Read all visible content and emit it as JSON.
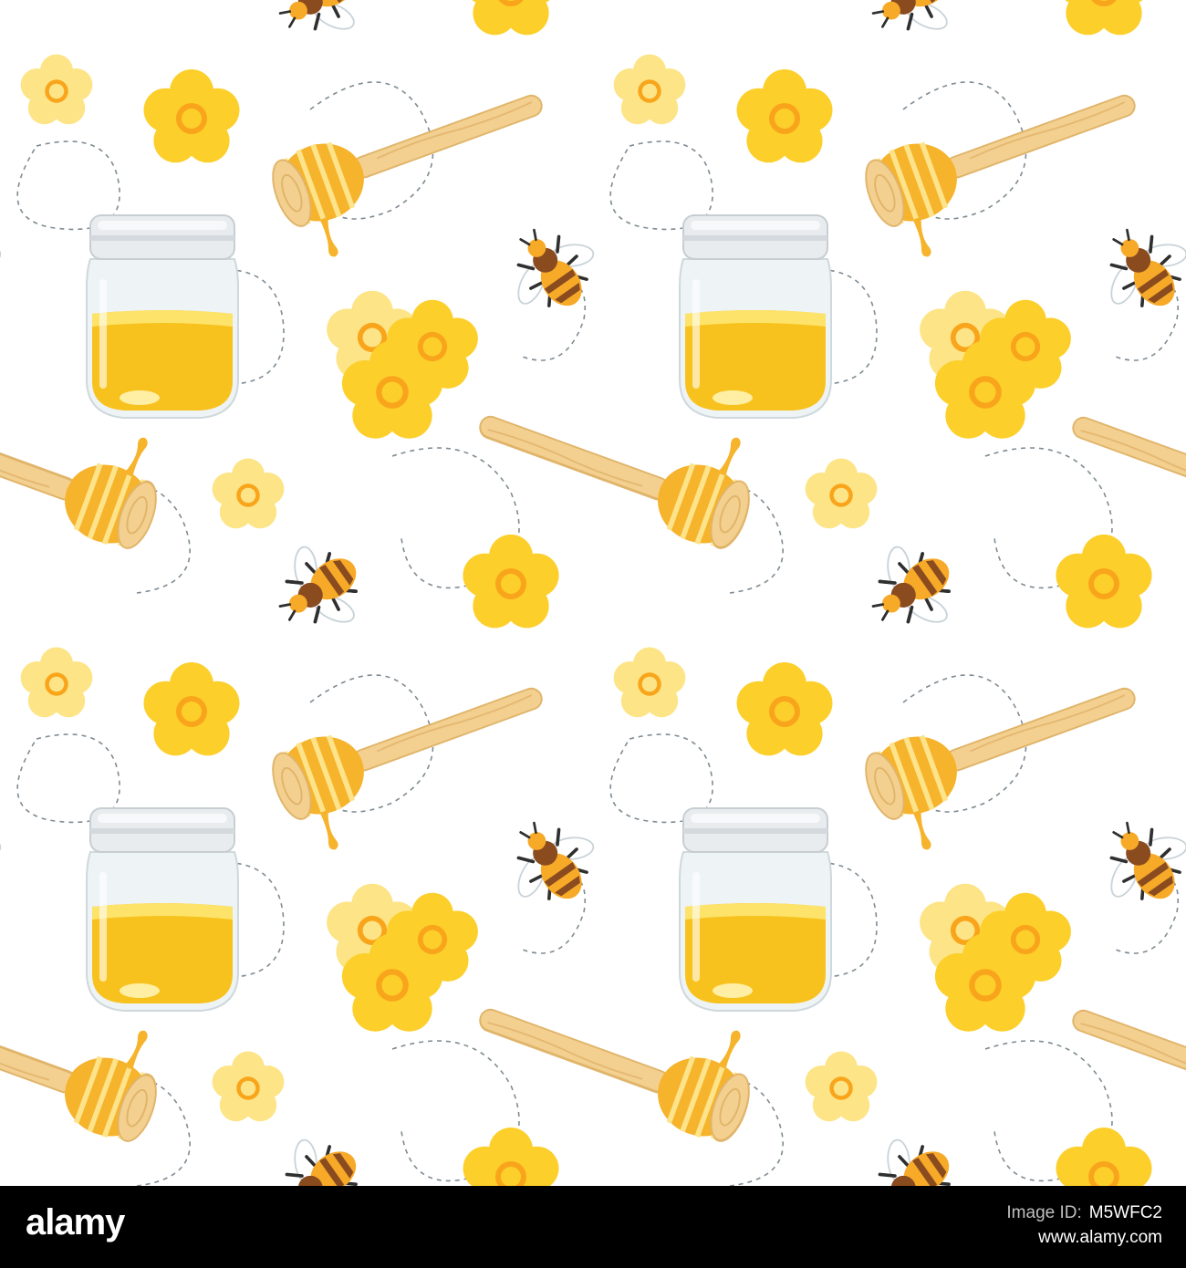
{
  "colors": {
    "background": "#ffffff",
    "honey": "#f6c321",
    "honey_light": "#fde36a",
    "flower_petal": "#fccf2b",
    "flower_petal_light": "#fde486",
    "flower_center": "#f9a51b",
    "wood": "#f2cf8d",
    "bee_body": "#f7a928",
    "bee_stripe": "#8a4b1f",
    "trail": "#7f8b93",
    "footer_bg": "#000000"
  },
  "footer": {
    "brand": "alamy",
    "image_id_label": "Image ID:",
    "image_id": "M5WFC2",
    "url": "www.alamy.com"
  },
  "pattern": {
    "motifs": [
      "honey-jar",
      "honey-dipper",
      "bee",
      "yellow-flower",
      "flower-cluster",
      "dashed-flight-trail"
    ]
  }
}
